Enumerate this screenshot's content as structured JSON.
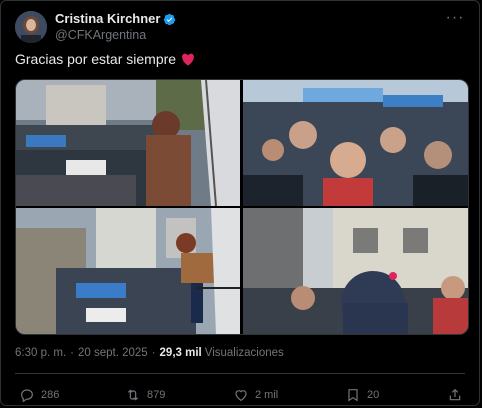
{
  "author": {
    "display_name": "Cristina Kirchner",
    "handle": "@CFKArgentina",
    "verified": true
  },
  "tweet": {
    "text": "Gracias por estar siempre",
    "emoji": "red-heart"
  },
  "media": {
    "photos": [
      {
        "name": "balcony-crowd-photo"
      },
      {
        "name": "crowd-closeup-photo"
      },
      {
        "name": "balcony-street-photo"
      },
      {
        "name": "street-crowd-photo"
      }
    ]
  },
  "meta": {
    "time": "6:30 p. m.",
    "separator": "·",
    "date": "20 sept. 2025",
    "separator2": "·",
    "views_count": "29,3 mil",
    "views_label": "Visualizaciones"
  },
  "actions": {
    "replies": "286",
    "reposts": "879",
    "likes": "2 mil",
    "bookmarks": "20"
  },
  "colors": {
    "background": "#000000",
    "text": "#e7e9ea",
    "secondary": "#71767b",
    "verified": "#1d9bf0",
    "heart": "#e0245e"
  }
}
